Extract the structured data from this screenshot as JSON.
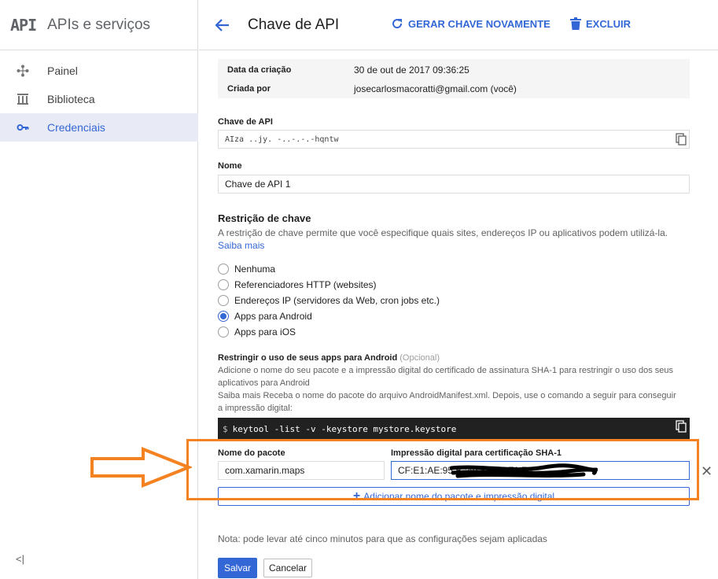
{
  "sidebar": {
    "logo": "API",
    "title": "APIs e serviços",
    "items": [
      {
        "label": "Painel",
        "icon": "dashboard-icon"
      },
      {
        "label": "Biblioteca",
        "icon": "library-icon"
      },
      {
        "label": "Credenciais",
        "icon": "key-icon",
        "active": true
      }
    ],
    "collapse_label": "<|"
  },
  "header": {
    "title": "Chave de API",
    "regenerate_label": "GERAR CHAVE NOVAMENTE",
    "delete_label": "EXCLUIR"
  },
  "info": {
    "created_key": "Data da criação",
    "created_value": "30 de out de 2017 09:36:25",
    "by_key": "Criada por",
    "by_value": "josecarlosmacoratti@gmail.com (você)"
  },
  "api_key": {
    "label": "Chave de API",
    "value": "AIza        ..jy.       -..-.-.-hqntw"
  },
  "name": {
    "label": "Nome",
    "value": "Chave de API 1"
  },
  "restriction": {
    "title": "Restrição de chave",
    "description": "A restrição de chave permite que você especifique quais sites, endereços IP ou aplicativos podem utilizá-la.",
    "learn_more": "Saiba mais",
    "options": [
      "Nenhuma",
      "Referenciadores HTTP (websites)",
      "Endereços IP (servidores da Web, cron jobs etc.)",
      "Apps para Android",
      "Apps para iOS"
    ],
    "selected": "Apps para Android"
  },
  "android": {
    "title": "Restringir o uso de seus apps para Android",
    "optional": "(Opcional)",
    "desc1": "Adicione o nome do seu pacote e a impressão digital do certificado de assinatura SHA-1 para restringir o uso dos seus aplicativos para Android",
    "desc2": "Saiba mais Receba o nome do pacote do arquivo AndroidManifest.xml. Depois, use o comando a seguir para conseguir a impressão digital:",
    "command_prompt": "$",
    "command": "keytool -list -v -keystore mystore.keystore",
    "package_label": "Nome do pacote",
    "package_value": "com.xamarin.maps",
    "sha_label": "Impressão digital para certificação SHA-1",
    "sha_value": "CF:E1:AE:95:B                              :49:6D:57:F1:76",
    "remove_symbol": "✕",
    "add_label": "Adicionar nome do pacote e impressão digital"
  },
  "footer": {
    "note": "Nota: pode levar até cinco minutos para que as configurações sejam aplicadas",
    "save_label": "Salvar",
    "cancel_label": "Cancelar"
  },
  "colors": {
    "accent": "#3367d6",
    "annotation": "#f58220"
  }
}
